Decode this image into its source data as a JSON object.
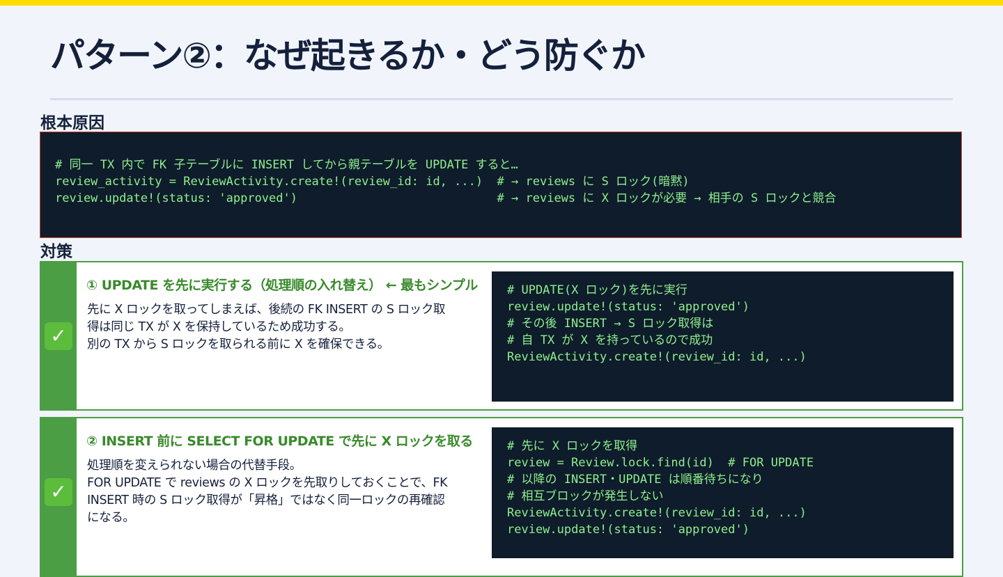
{
  "title": "パターン②：なぜ起きるか・どう防ぐか",
  "root_cause": {
    "heading": "根本原因",
    "code": [
      "# 同一 TX 内で FK 子テーブルに INSERT してから親テーブルを UPDATE すると…",
      "review_activity = ReviewActivity.create!(review_id: id, ...)  # → reviews に S ロック(暗黙)",
      "review.update!(status: 'approved')                            # → reviews に X ロックが必要 → 相手の S ロックと競合"
    ]
  },
  "countermeasures": {
    "heading": "対策",
    "items": [
      {
        "icon": "check-mark-icon",
        "icon_glyph": "✓",
        "title": "① UPDATE を先に実行する（処理順の入れ替え） ← 最もシンプル",
        "description": [
          "先に X ロックを取ってしまえば、後続の FK INSERT の S ロック取",
          "得は同じ TX が X を保持しているため成功する。",
          "別の TX から S ロックを取られる前に X を確保できる。"
        ],
        "code": [
          "# UPDATE(X ロック)を先に実行",
          "review.update!(status: 'approved')",
          "# その後 INSERT → S ロック取得は",
          "# 自 TX が X を持っているので成功",
          "ReviewActivity.create!(review_id: id, ...)"
        ]
      },
      {
        "icon": "check-mark-icon",
        "icon_glyph": "✓",
        "title": "② INSERT 前に SELECT FOR UPDATE で先に X ロックを取る",
        "description": [
          "処理順を変えられない場合の代替手段。",
          "FOR UPDATE で reviews の X ロックを先取りしておくことで、FK",
          "INSERT 時の S ロック取得が「昇格」ではなく同一ロックの再確認",
          "になる。"
        ],
        "code": [
          "# 先に X ロックを取得",
          "review = Review.lock.find(id)  # FOR UPDATE",
          "# 以降の INSERT・UPDATE は順番待ちになり",
          "# 相互ブロックが発生しない",
          "ReviewActivity.create!(review_id: id, ...)",
          "review.update!(status: 'approved')"
        ]
      }
    ]
  },
  "colors": {
    "top_bar": "#ffdc00",
    "background": "#f1f5fb",
    "title_text": "#15213b",
    "code_background": "#0f1c2b",
    "code_text": "#8ef08e",
    "cause_border": "#d1492c",
    "countermeasure_accent": "#4b9e44",
    "countermeasure_title": "#3a8a2c"
  }
}
